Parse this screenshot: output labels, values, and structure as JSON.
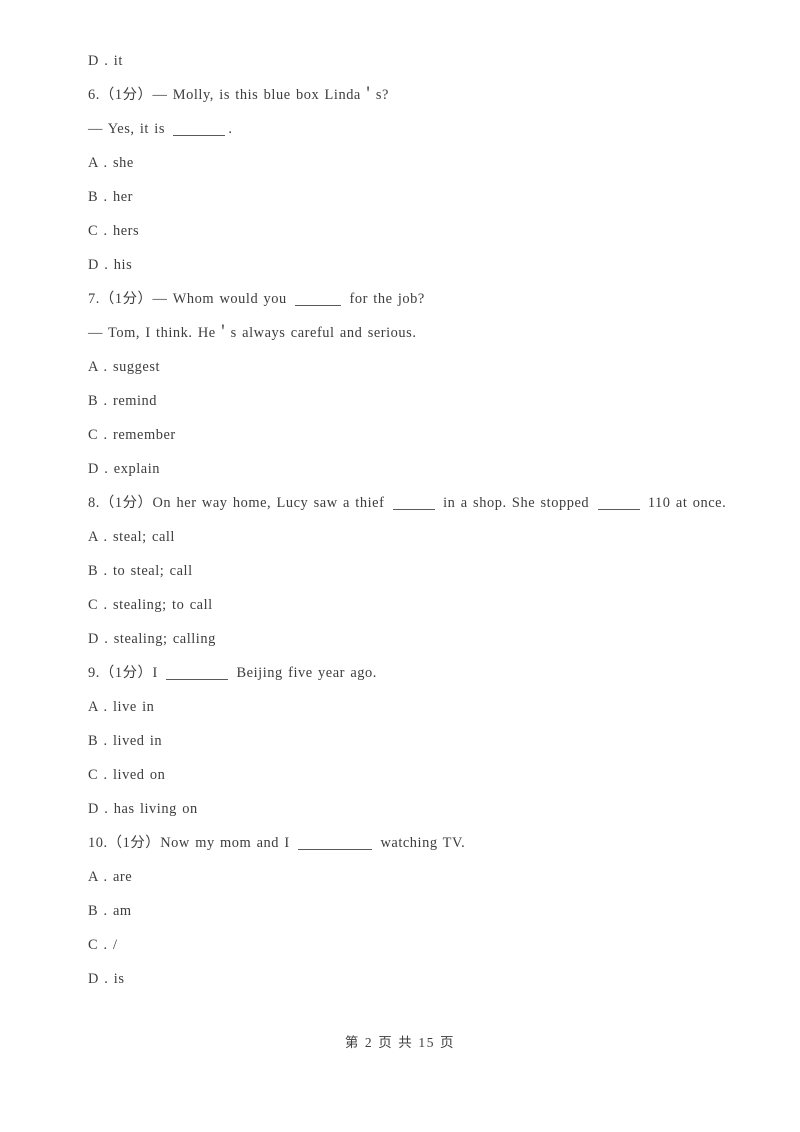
{
  "document": {
    "page_label": "第 2 页 共 15 页",
    "page_number": 2,
    "total_pages": 15,
    "text_color": "#3d3d3d",
    "background_color": "#ffffff"
  },
  "body": {
    "orphan_option": {
      "letter": "D",
      "separator": ".",
      "text": "it",
      "full": "D . it"
    },
    "questions": [
      {
        "number": "6.",
        "marks": "（1分）",
        "stem_line_1": "— Molly, is this blue box Linda＇s?",
        "stem_line_2_prefix": "— Yes, it is ",
        "stem_line_2_suffix": ".",
        "options": [
          "A . she",
          "B . her",
          "C . hers",
          "D . his"
        ]
      },
      {
        "number": "7.",
        "marks": "（1分）",
        "stem_line_1_prefix": "— Whom would you ",
        "stem_line_1_suffix": " for the job?",
        "stem_line_2": "— Tom, I think. He＇s always careful and serious.",
        "options": [
          "A . suggest",
          "B . remind",
          "C . remember",
          "D . explain"
        ]
      },
      {
        "number": "8.",
        "marks": "（1分）",
        "stem_part_1": "On her way home, Lucy saw a thief ",
        "stem_part_2": " in a shop. She stopped ",
        "stem_part_3": " 110 at once.",
        "options": [
          "A . steal; call",
          "B . to steal; call",
          "C . stealing; to call",
          "D . stealing; calling"
        ]
      },
      {
        "number": "9.",
        "marks": "（1分）",
        "stem_part_1": "I ",
        "stem_part_2": " Beijing five year ago.",
        "options": [
          "A . live in",
          "B . lived in",
          "C . lived on",
          "D . has living on"
        ]
      },
      {
        "number": "10.",
        "marks": "（1分）",
        "stem_part_1": "Now my mom and I ",
        "stem_part_2": " watching TV.",
        "options": [
          "A . are",
          "B . am",
          "C . /",
          "D . is"
        ]
      }
    ]
  }
}
